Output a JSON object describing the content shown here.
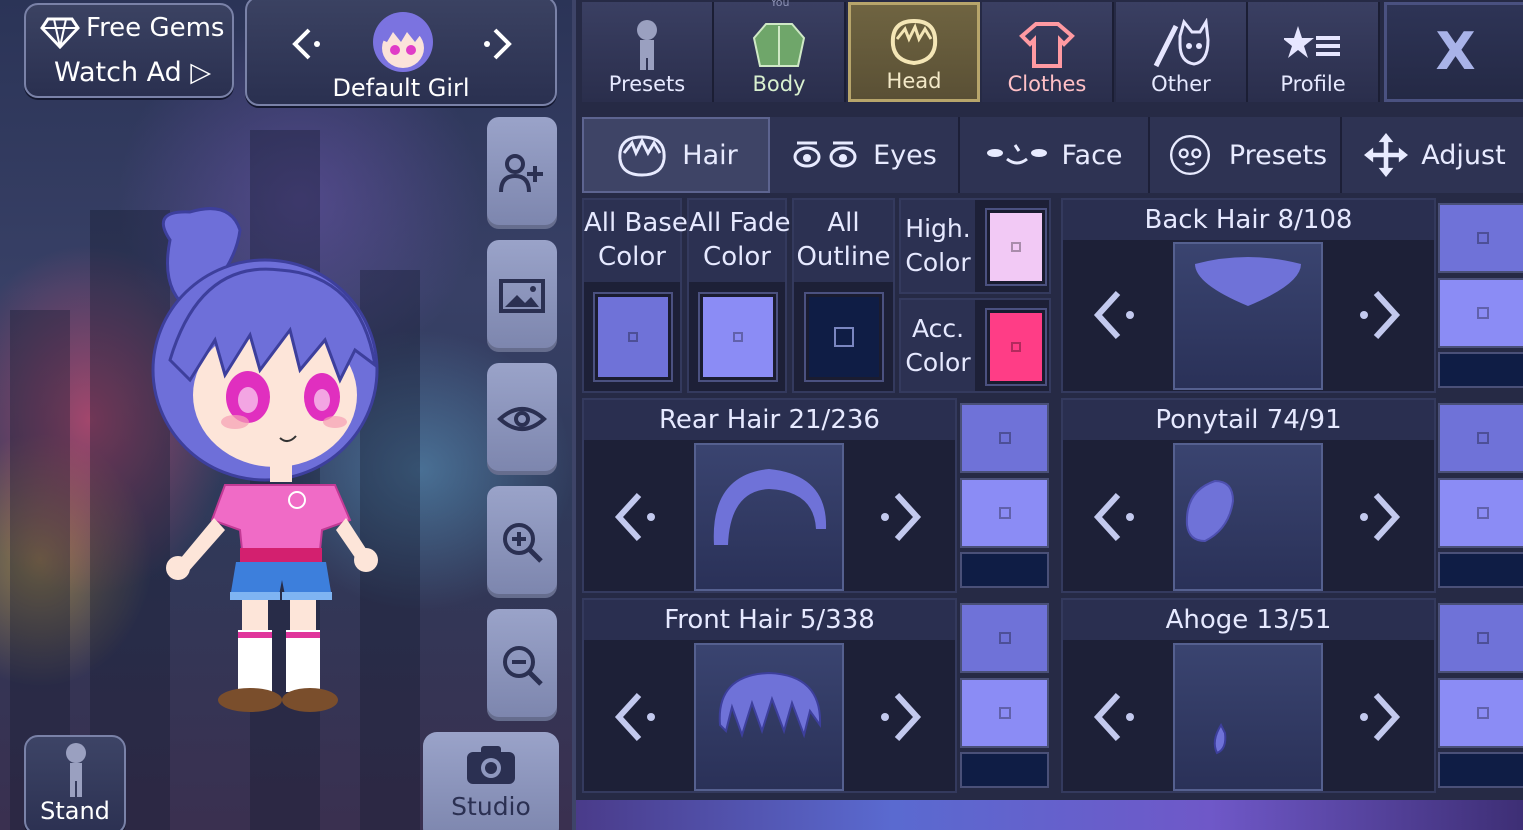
{
  "colors": {
    "panel_bg": "#262a45",
    "active_tab": "#6f6441",
    "hair_base": "#6f72d8",
    "hair_fade": "#8b8cf5",
    "hair_outline": "#0f1d45",
    "highlight": "#f2c9f5",
    "accessory": "#ff3d86"
  },
  "header": {
    "free_gems_label": "Free Gems",
    "watch_ad_label": "Watch Ad ▷",
    "character_name": "Default Girl"
  },
  "side_buttons": [
    {
      "icon": "add-person-icon"
    },
    {
      "icon": "background-image-icon"
    },
    {
      "icon": "eye-icon"
    },
    {
      "icon": "zoom-in-icon"
    },
    {
      "icon": "zoom-out-icon"
    }
  ],
  "bottom": {
    "stand_label": "Stand",
    "studio_label": "Studio"
  },
  "top_tabs": [
    {
      "label": "Presets",
      "icon": "person-silhouette-icon",
      "active": false
    },
    {
      "label": "Body",
      "icon": "jacket-icon",
      "active": false
    },
    {
      "label": "Head",
      "icon": "hair-head-icon",
      "active": true
    },
    {
      "label": "Clothes",
      "icon": "shirt-icon",
      "active": false
    },
    {
      "label": "Other",
      "icon": "sword-cat-icon",
      "active": false
    },
    {
      "label": "Profile",
      "icon": "star-list-icon",
      "active": false
    }
  ],
  "close_label": "X",
  "body_tab_overlap_text": "You",
  "sub_tabs": [
    {
      "label": "Hair",
      "icon": "hair-icon",
      "active": true
    },
    {
      "label": "Eyes",
      "icon": "eyes-icon",
      "active": false
    },
    {
      "label": "Face",
      "icon": "face-icon",
      "active": false
    },
    {
      "label": "Presets",
      "icon": "face-preset-icon",
      "active": false
    },
    {
      "label": "Adjust",
      "icon": "move-arrows-icon",
      "active": false
    }
  ],
  "color_buttons": [
    {
      "label_line1": "All Base",
      "label_line2": "Color"
    },
    {
      "label_line1": "All Fade",
      "label_line2": "Color"
    },
    {
      "label_line1": "All",
      "label_line2": "Outline"
    }
  ],
  "high_color": {
    "label_line1": "High.",
    "label_line2": "Color"
  },
  "acc_color": {
    "label_line1": "Acc.",
    "label_line2": "Color"
  },
  "slots": {
    "back_hair": {
      "title": "Back Hair 8/108"
    },
    "rear_hair": {
      "title": "Rear Hair 21/236"
    },
    "ponytail": {
      "title": "Ponytail 74/91"
    },
    "front_hair": {
      "title": "Front Hair 5/338"
    },
    "ahoge": {
      "title": "Ahoge 13/51"
    }
  }
}
